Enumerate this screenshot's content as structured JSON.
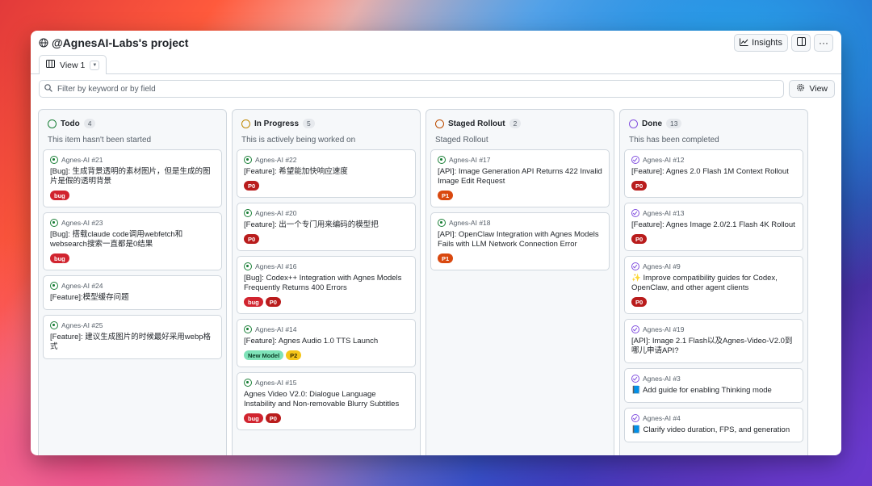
{
  "colors": {
    "todo": "#1a7f37",
    "in_progress": "#bf8700",
    "staged": "#bc4c00",
    "done": "#8250df"
  },
  "header": {
    "title": "@AgnesAI-Labs's project",
    "globe_icon": "globe-icon",
    "insights_label": "Insights"
  },
  "tabs": [
    {
      "label": "View 1",
      "icon": "board-icon"
    }
  ],
  "filter": {
    "placeholder": "Filter by keyword or by field",
    "view_label": "View"
  },
  "columns": [
    {
      "name": "Todo",
      "count": "4",
      "description": "This item hasn't been started",
      "status": "todo",
      "cards": [
        {
          "meta": "Agnes-AI #21",
          "title": "[Bug]: 生成背景透明的素材图片，但是生成的图片是假的透明背景",
          "labels": [
            {
              "text": "bug",
              "kind": "bug"
            }
          ]
        },
        {
          "meta": "Agnes-AI #23",
          "title": "[Bug]: 搭载claude code调用webfetch和websearch搜索一直都是0结果",
          "labels": [
            {
              "text": "bug",
              "kind": "bug"
            }
          ]
        },
        {
          "meta": "Agnes-AI #24",
          "title": "[Feature]:模型缓存问题",
          "labels": []
        },
        {
          "meta": "Agnes-AI #25",
          "title": "[Feature]: 建议生成图片的时候最好采用webp格式",
          "labels": []
        }
      ]
    },
    {
      "name": "In Progress",
      "count": "5",
      "description": "This is actively being worked on",
      "status": "in_progress",
      "cards": [
        {
          "meta": "Agnes-AI #22",
          "title": "[Feature]: 希望能加快响应速度",
          "labels": [
            {
              "text": "P0",
              "kind": "p0"
            }
          ]
        },
        {
          "meta": "Agnes-AI #20",
          "title": "[Feature]: 出一个专门用来编码的模型把",
          "labels": [
            {
              "text": "P0",
              "kind": "p0"
            }
          ]
        },
        {
          "meta": "Agnes-AI #16",
          "title": "[Bug]: Codex++ Integration with Agnes Models Frequently Returns 400 Errors",
          "labels": [
            {
              "text": "bug",
              "kind": "bug"
            },
            {
              "text": "P0",
              "kind": "p0"
            }
          ]
        },
        {
          "meta": "Agnes-AI #14",
          "title": "[Feature]: Agnes Audio 1.0 TTS Launch",
          "labels": [
            {
              "text": "New Model",
              "kind": "newmodel"
            },
            {
              "text": "P2",
              "kind": "p2"
            }
          ]
        },
        {
          "meta": "Agnes-AI #15",
          "title": "Agnes Video V2.0: Dialogue Language Instability and Non-removable Blurry Subtitles",
          "labels": [
            {
              "text": "bug",
              "kind": "bug"
            },
            {
              "text": "P0",
              "kind": "p0"
            }
          ]
        }
      ]
    },
    {
      "name": "Staged Rollout",
      "count": "2",
      "description": "Staged Rollout",
      "status": "staged",
      "cards": [
        {
          "meta": "Agnes-AI #17",
          "title": "[API]: Image Generation API Returns 422 Invalid Image Edit Request",
          "labels": [
            {
              "text": "P1",
              "kind": "p1"
            }
          ]
        },
        {
          "meta": "Agnes-AI #18",
          "title": "[API]: OpenClaw Integration with Agnes Models Fails with LLM Network Connection Error",
          "labels": [
            {
              "text": "P1",
              "kind": "p1"
            }
          ]
        }
      ]
    },
    {
      "name": "Done",
      "count": "13",
      "description": "This has been completed",
      "status": "done",
      "cards": [
        {
          "meta": "Agnes-AI #12",
          "title": "[Feature]: Agnes 2.0 Flash 1M Context Rollout",
          "labels": [
            {
              "text": "P0",
              "kind": "p0"
            }
          ]
        },
        {
          "meta": "Agnes-AI #13",
          "title": "[Feature]: Agnes Image 2.0/2.1 Flash 4K Rollout",
          "labels": [
            {
              "text": "P0",
              "kind": "p0"
            }
          ]
        },
        {
          "meta": "Agnes-AI #9",
          "title": "✨ Improve compatibility guides for Codex, OpenClaw, and other agent clients",
          "labels": [
            {
              "text": "P0",
              "kind": "p0"
            }
          ]
        },
        {
          "meta": "Agnes-AI #19",
          "title": "[API]: Image 2.1 Flash以及Agnes-Video-V2.0到哪儿申请API?",
          "labels": []
        },
        {
          "meta": "Agnes-AI #3",
          "title": "📘 Add guide for enabling Thinking mode",
          "labels": []
        },
        {
          "meta": "Agnes-AI #4",
          "title": "📘 Clarify video duration, FPS, and generation",
          "labels": []
        }
      ]
    }
  ]
}
